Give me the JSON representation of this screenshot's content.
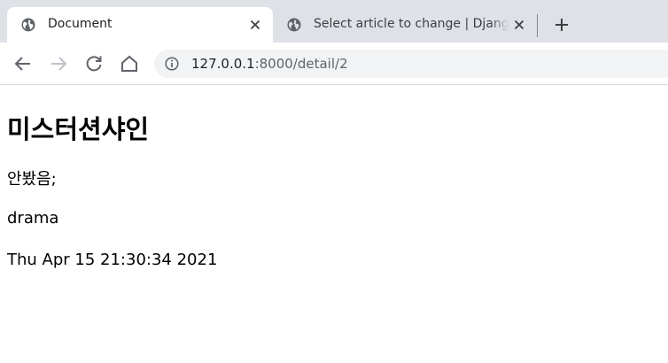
{
  "browser": {
    "tabs": [
      {
        "title": "Document",
        "active": true
      },
      {
        "title": "Select article to change | Django site admin",
        "active": false
      }
    ],
    "address": {
      "host": "127.0.0.1",
      "path": ":8000/detail/2"
    }
  },
  "content": {
    "heading": "미스터션샤인",
    "review": "안봤음;",
    "genre": "drama",
    "date": "Thu Apr 15 21:30:34 2021"
  },
  "colors": {
    "tabstrip": "#dee1e6",
    "icon": "#5f6368",
    "omnibox": "#f1f3f4"
  }
}
